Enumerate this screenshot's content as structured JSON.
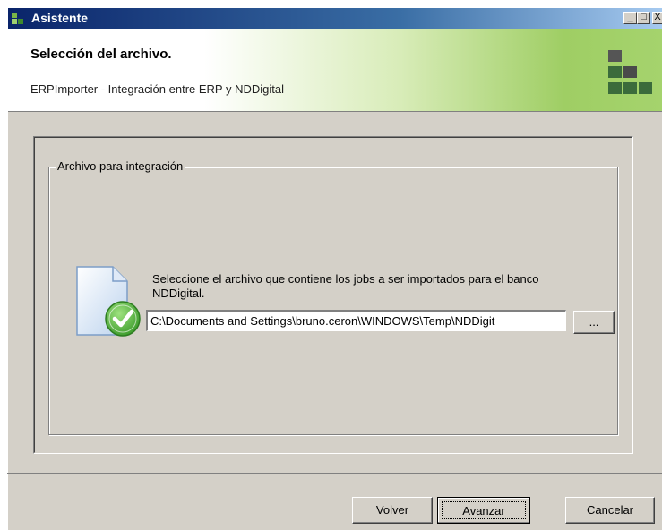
{
  "window": {
    "title": "Asistente",
    "controls": {
      "minimize": "_",
      "maximize": "□",
      "close": "X"
    }
  },
  "header": {
    "title": "Selección del archivo.",
    "subtitle": "ERPImporter - Integración entre ERP y NDDigital",
    "logo_icon": "nddigital-logo-icon"
  },
  "group": {
    "legend": "Archivo para integración",
    "instruction": "Seleccione el archivo que contiene los jobs a ser importados para el banco NDDigital.",
    "file_path": "C:\\Documents and Settings\\bruno.ceron\\WINDOWS\\Temp\\NDDigit",
    "browse_label": "...",
    "icon": "document-check-icon"
  },
  "footer": {
    "back_label": "Volver",
    "next_label": "Avanzar",
    "cancel_label": "Cancelar"
  },
  "colors": {
    "titlebar_start": "#0a246a",
    "titlebar_end": "#a6caf0",
    "header_green": "#9fce64",
    "dialog_bg": "#d4d0c8",
    "check_green": "#4caf3a"
  }
}
